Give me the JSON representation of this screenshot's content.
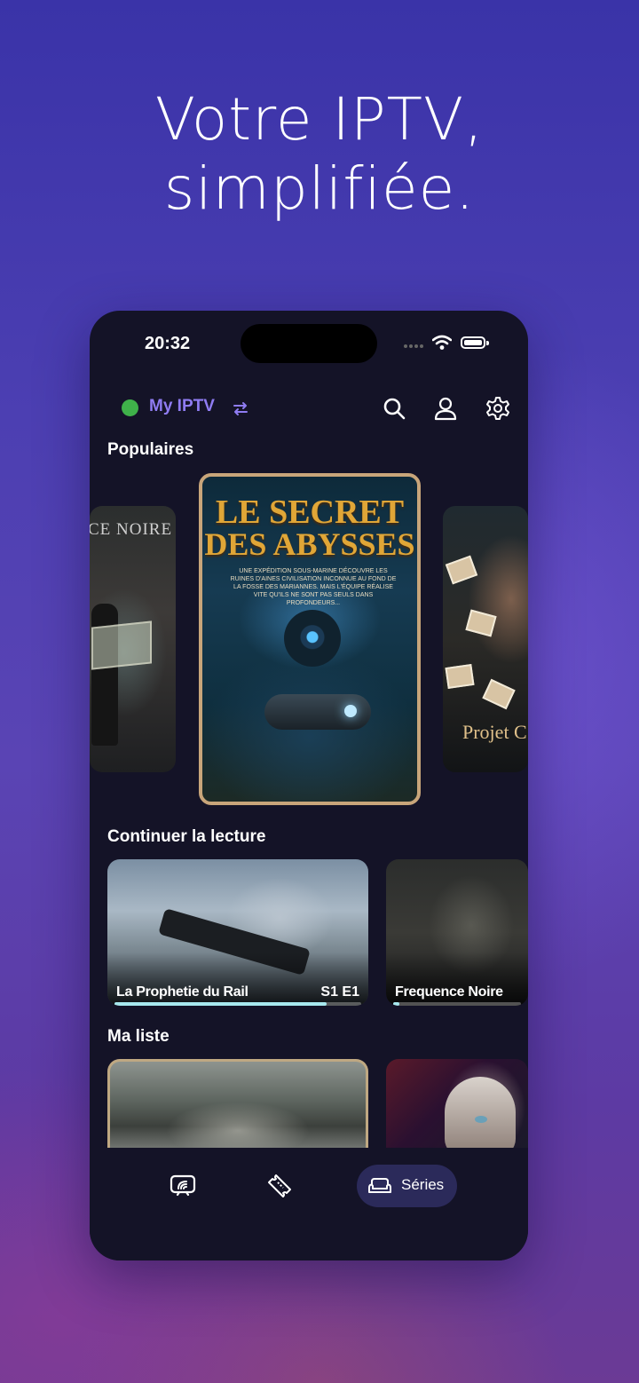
{
  "headline": {
    "line1": "Votre IPTV,",
    "line2": "simplifiée."
  },
  "status_bar": {
    "time": "20:32"
  },
  "header": {
    "app_name": "My IPTV"
  },
  "sections": {
    "popular": "Populaires",
    "continue": "Continuer la lecture",
    "my_list": "Ma liste"
  },
  "popular_posters": [
    {
      "title": "CE NOIRE"
    },
    {
      "title_line1": "LE SECRET",
      "title_line2": "DES ABYSSES",
      "tagline": "UNE EXPÉDITION SOUS-MARINE DÉCOUVRE LES RUINES D'AINES CIVILISATION INCONNUE AU FOND DE LA FOSSE DES MARIANNES. MAIS L'ÉQUIPE RÉALISE VITE QU'ILS NE SONT PAS SEULS DANS PROFONDEURS..."
    },
    {
      "title": "Projet C"
    }
  ],
  "continue_watching": [
    {
      "title": "La Prophetie du Rail",
      "episode": "S1 E1",
      "progress": 0.86
    },
    {
      "title": "Frequence Noire",
      "progress": 0.05
    }
  ],
  "tabbar": {
    "active_label": "Séries"
  },
  "colors": {
    "accent": "#8f7cf2",
    "live": "#3fb14a",
    "progress": "#a7e8ee",
    "tab_active_bg": "#2b2a5a"
  }
}
